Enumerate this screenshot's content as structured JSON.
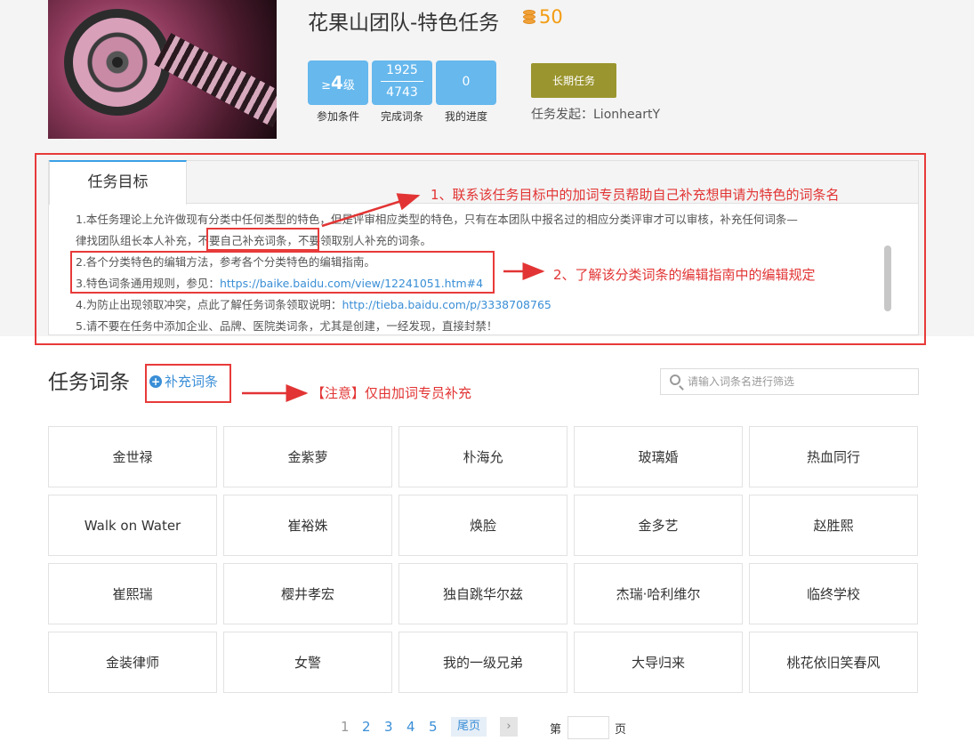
{
  "header": {
    "title": "花果山团队-特色任务",
    "coin_value": "50",
    "level_prefix": "≥",
    "level_number": "4",
    "level_suffix": "级",
    "level_label": "参加条件",
    "words_done": "1925",
    "words_total": "4743",
    "words_label": "完成词条",
    "progress_value": "0",
    "progress_label": "我的进度",
    "long_task_button": "长期任务",
    "initiator": "任务发起：LionheartY"
  },
  "goal": {
    "tab_label": "任务目标",
    "line1_a": "1.本任务理论上允许做现有分类中任何类型的特色，但是评审相应类型的特色，只有在本团队中报名过的相应分类评审才可以审核，补充任何词条—",
    "line1_b": "律找团队组长本人补充，",
    "line1_c": "不要自己补充词条",
    "line1_d": "，不要领取别人补充的词条。",
    "line2": "2.各个分类特色的编辑方法，参考各个分类特色的编辑指南。",
    "line3_a": "3.特色词条通用规则，参见：",
    "line3_link": "https://baike.baidu.com/view/12241051.htm#4",
    "line4_a": "4.为防止出现领取冲突，点此了解任务词条领取说明：",
    "line4_link": "http://tieba.baidu.com/p/3338708765",
    "line5": "5.请不要在任务中添加企业、品牌、医院类词条，尤其是创建，一经发现，直接封禁！"
  },
  "annotations": {
    "note1": "1、联系该任务目标中的加词专员帮助自己补充想申请为特色的词条名",
    "note2": "2、了解该分类词条的编辑指南中的编辑规定",
    "note3": "【注意】仅由加词专员补充"
  },
  "words": {
    "section_title": "任务词条",
    "add_button": "补充词条",
    "search_placeholder": "请输入词条名进行筛选",
    "items": [
      "金世禄",
      "金紫萝",
      "朴海允",
      "玻璃婚",
      "热血同行",
      "Walk on Water",
      "崔裕姝",
      "焕脸",
      "金多艺",
      "赵胜熙",
      "崔熙瑞",
      "樱井孝宏",
      "独自跳华尔兹",
      "杰瑞·哈利维尔",
      "临终学校",
      "金装律师",
      "女警",
      "我的一级兄弟",
      "大导归来",
      "桃花依旧笑春风"
    ]
  },
  "pagination": {
    "pages": [
      "1",
      "2",
      "3",
      "4",
      "5"
    ],
    "current_page": "1",
    "last_label": "尾页",
    "next_label": "›",
    "goto_prefix": "第",
    "goto_suffix": "页"
  },
  "colors": {
    "accent_blue": "#66b8ed",
    "link_blue": "#3a8ed6",
    "long_task_olive": "#9a952e",
    "coin_orange": "#f39c12",
    "annotation_red": "#e23434"
  }
}
